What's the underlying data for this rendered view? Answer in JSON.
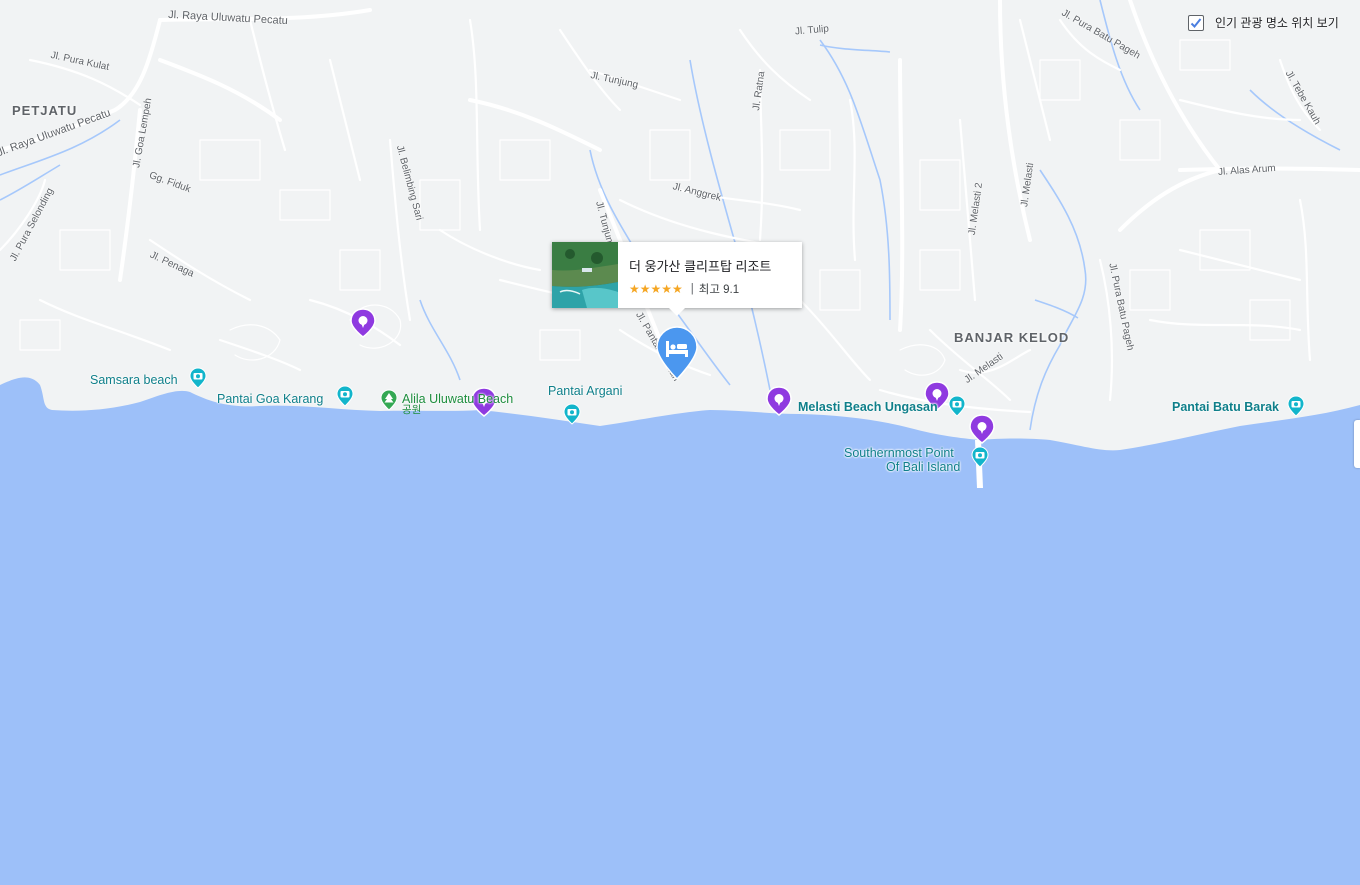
{
  "colors": {
    "land": "#f1f3f4",
    "sea": "#9dc0f9",
    "road": "#ffffff",
    "stream": "#a6c8fb",
    "poi": "#0f7f8a",
    "park": "#1e8e3e",
    "pin_purple": "#8f3ae0",
    "hotel_pin": "#4b97ef",
    "star": "#f5a623"
  },
  "toggle": {
    "label": "인기 관광 명소 위치 보기",
    "checked": true
  },
  "areas": [
    "PETJATU",
    "BANJAR KELOD"
  ],
  "roads": [
    "Jl. Raya Uluwatu Pecatu",
    "Jl. Pura Kulat",
    "Jl. Raya Uluwatu Pecatu",
    "Jl. Goa Lempeh",
    "Gg. Fiduk",
    "Jl. Pura Selonding",
    "Jl. Penaga",
    "Jl. Belimbing Sari",
    "Jl. Tunjung",
    "Jl. Tunjung",
    "Jl. Anggrek",
    "Jl. Ratna",
    "Jl. Tulip",
    "Jl. Pura Batu Pageh",
    "Jl. Tebe Kauh",
    "Jl. Alas Arum",
    "Jl. Melasti 2",
    "Jl. Melasti",
    "Jl. Pura Batu Pageh",
    "Jl. Melasti",
    "Jl. Pantai Selatan"
  ],
  "pois": [
    "Samsara beach",
    "Pantai Goa Karang",
    "Pantai Argani",
    "Melasti Beach Ungasan",
    "Southernmost Point",
    "Of Bali Island",
    "Pantai Batu Barak"
  ],
  "park": {
    "name": "Alila Uluwatu Beach",
    "sub": "공원"
  },
  "popup": {
    "title": "더 웅가산 클리프탑 리조트",
    "stars": "★★★★★",
    "rating": "최고 9.1",
    "separator": "|"
  },
  "markers": {
    "hotel_icon": "bed-icon",
    "place_icon": "place-pin-icon",
    "poi_icon": "camera-icon",
    "park_icon": "tree-icon"
  }
}
